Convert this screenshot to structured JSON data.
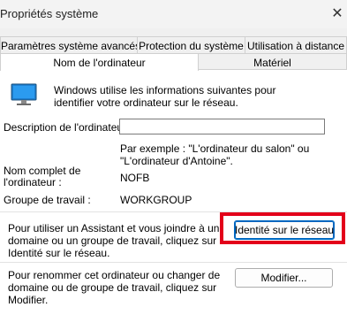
{
  "window": {
    "title": "Propriétés système"
  },
  "tabs": {
    "row1": [
      "Paramètres système avancés",
      "Protection du système",
      "Utilisation à distance"
    ],
    "row2": [
      "Nom de l'ordinateur",
      "Matériel"
    ]
  },
  "intro": "Windows utilise les informations suivantes pour identifier votre ordinateur sur le réseau.",
  "description": {
    "label": "Description de l'ordinateur :",
    "value": "",
    "example": "Par exemple : \"L'ordinateur du salon\" ou \"L'ordinateur d'Antoine\"."
  },
  "fullname": {
    "label": "Nom complet de l'ordinateur :",
    "value": "NOFB"
  },
  "workgroup": {
    "label": "Groupe de travail :",
    "value": "WORKGROUP"
  },
  "network": {
    "text": "Pour utiliser un Assistant et vous joindre à un domaine ou un groupe de travail, cliquez sur Identité sur le réseau.",
    "button": "Identité sur le réseau..."
  },
  "rename": {
    "text": "Pour renommer cet ordinateur ou changer de domaine ou de groupe de travail, cliquez sur Modifier.",
    "button": "Modifier..."
  },
  "icons": {
    "close": "close-icon",
    "computer": "monitor-icon"
  },
  "colors": {
    "highlight": "#e3001a",
    "accent": "#0067c0"
  }
}
